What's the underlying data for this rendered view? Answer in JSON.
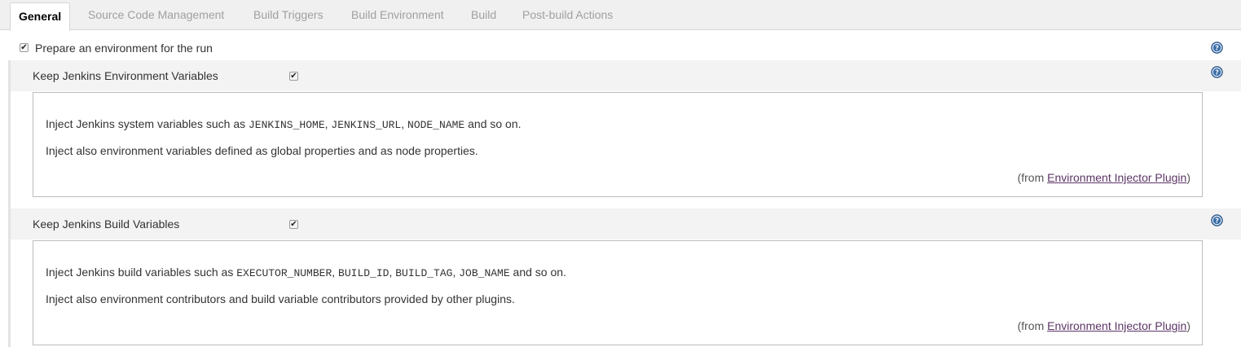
{
  "tabs": [
    {
      "label": "General",
      "active": true
    },
    {
      "label": "Source Code Management"
    },
    {
      "label": "Build Triggers"
    },
    {
      "label": "Build Environment"
    },
    {
      "label": "Build"
    },
    {
      "label": "Post-build Actions"
    }
  ],
  "prepare_env": {
    "label": "Prepare an environment for the run",
    "checked": true
  },
  "keep_env_vars": {
    "label": "Keep Jenkins Environment Variables",
    "checked": true,
    "help": {
      "line1_prefix": "Inject Jenkins system variables such as ",
      "var1": "JENKINS_HOME",
      "sep1": ", ",
      "var2": "JENKINS_URL",
      "sep2": ", ",
      "var3": "NODE_NAME",
      "line1_suffix": " and so on.",
      "line2": "Inject also environment variables defined as global properties and as node properties.",
      "from_prefix": "(from ",
      "plugin_link": "Environment Injector Plugin",
      "from_suffix": ")"
    }
  },
  "keep_build_vars": {
    "label": "Keep Jenkins Build Variables",
    "checked": true,
    "help": {
      "line1_prefix": "Inject Jenkins build variables such as ",
      "var1": "EXECUTOR_NUMBER",
      "sep1": ", ",
      "var2": "BUILD_ID",
      "sep2": ", ",
      "var3": "BUILD_TAG",
      "sep3": ", ",
      "var4": "JOB_NAME",
      "line1_suffix": " and so on.",
      "line2": "Inject also environment contributors and build variable contributors provided by other plugins.",
      "from_prefix": "(from ",
      "plugin_link": "Environment Injector Plugin",
      "from_suffix": ")"
    }
  },
  "icons": {
    "help": "help-question-icon",
    "checkbox_mark": "✔"
  },
  "colors": {
    "help_icon": "#3b6fa8",
    "link": "#5c3566",
    "band": "#f3f3f3"
  }
}
